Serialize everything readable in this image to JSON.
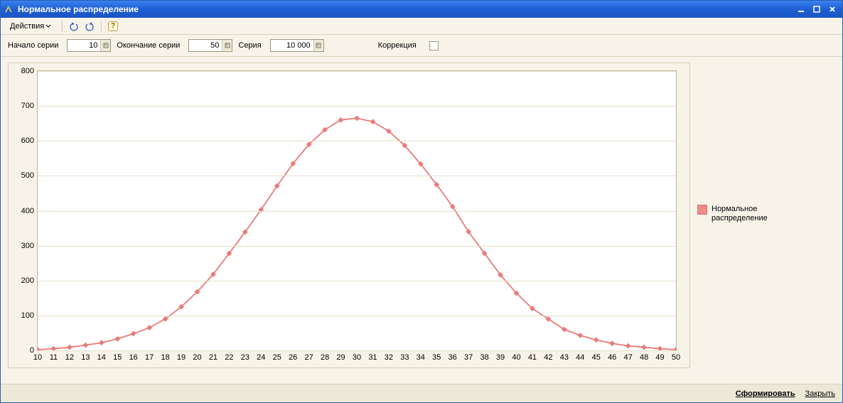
{
  "window": {
    "title": "Нормальное распределение"
  },
  "toolbar": {
    "actions_label": "Действия"
  },
  "params": {
    "series_start_label": "Начало серии",
    "series_start_value": "10",
    "series_end_label": "Окончание серии",
    "series_end_value": "50",
    "series_label": "Серия",
    "series_value": "10 000",
    "correction_label": "Коррекция",
    "correction_checked": false
  },
  "legend": {
    "series_name": "Нормальное\nраспределение"
  },
  "footer": {
    "generate_label": "Сформировать",
    "close_label": "Закрыть"
  },
  "colors": {
    "primary_series": "#e97b78",
    "grid": "#e5e1cc",
    "panel": "#f7f3e9"
  },
  "chart_data": {
    "type": "line",
    "title": "",
    "xlabel": "",
    "ylabel": "",
    "ylim": [
      0,
      800
    ],
    "y_ticks": [
      0,
      100,
      200,
      300,
      400,
      500,
      600,
      700,
      800
    ],
    "x": [
      10,
      11,
      12,
      13,
      14,
      15,
      16,
      17,
      18,
      19,
      20,
      21,
      22,
      23,
      24,
      25,
      26,
      27,
      28,
      29,
      30,
      31,
      32,
      33,
      34,
      35,
      36,
      37,
      38,
      39,
      40,
      41,
      42,
      43,
      44,
      45,
      46,
      47,
      48,
      49,
      50
    ],
    "series": [
      {
        "name": "Нормальное распределение",
        "color": "#e97b78",
        "values": [
          2,
          5,
          9,
          15,
          22,
          33,
          48,
          65,
          90,
          125,
          168,
          218,
          278,
          339,
          403,
          471,
          535,
          590,
          632,
          660,
          665,
          655,
          628,
          587,
          534,
          475,
          412,
          340,
          278,
          216,
          164,
          120,
          90,
          60,
          43,
          30,
          20,
          13,
          9,
          5,
          2
        ]
      }
    ]
  }
}
